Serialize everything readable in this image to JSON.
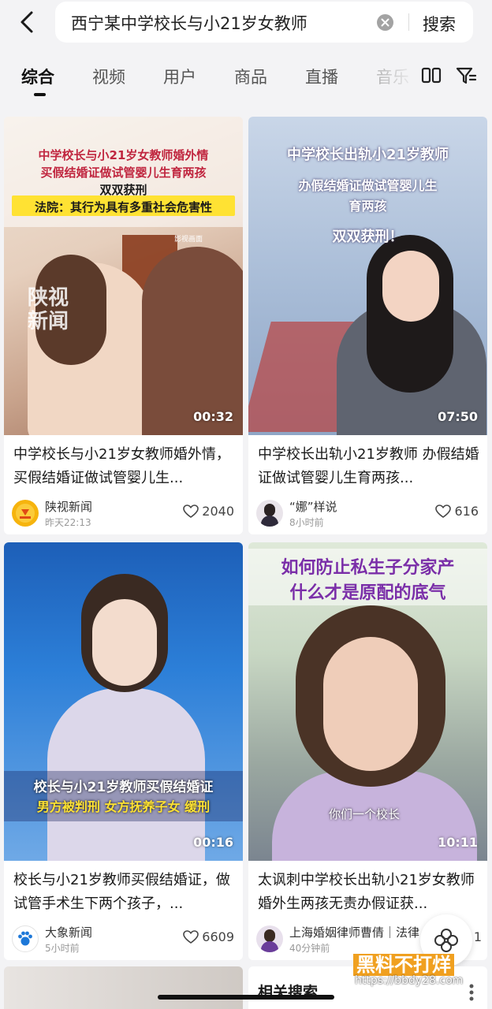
{
  "search": {
    "query": "西宁某中学校长与小21岁女教师",
    "button_label": "搜索"
  },
  "tabs": [
    {
      "label": "综合",
      "active": true
    },
    {
      "label": "视频",
      "active": false
    },
    {
      "label": "用户",
      "active": false
    },
    {
      "label": "商品",
      "active": false
    },
    {
      "label": "直播",
      "active": false
    },
    {
      "label": "音乐",
      "active": false
    }
  ],
  "cards": [
    {
      "duration": "00:32",
      "title": "中学校长与小21岁女教师婚外情，买假结婚证做试管婴儿生...",
      "author": "陕视新闻",
      "time": "昨天22:13",
      "likes": "2040",
      "overlay": [
        "中学校长与小21岁女教师婚外情",
        "买假结婚证做试管婴儿生育两孩",
        "双双获刑",
        "法院：其行为具有多重社会危害性"
      ],
      "watermark": "陕视\n新闻",
      "tag": "影视画面",
      "avatar_text": "陕视新闻"
    },
    {
      "duration": "07:50",
      "title": "中学校长出轨小21岁教师 办假结婚证做试管婴儿生育两孩...",
      "author": "“娜”样说",
      "time": "8小时前",
      "likes": "616",
      "overlay": [
        "中学校长出轨小21岁教师",
        "办假结婚证做试管婴儿生",
        "育两孩",
        "双双获刑！"
      ]
    },
    {
      "duration": "00:16",
      "title": "校长与小21岁教师买假结婚证，做试管手术生下两个孩子，...",
      "author": "大象新闻",
      "time": "5小时前",
      "likes": "6609",
      "overlay": [
        "校长与小21岁教师买假结婚证",
        "男方被判刑 女方抚养子女 缓刑"
      ],
      "avatar_text": "大象新闻"
    },
    {
      "duration": "10:11",
      "title": "太讽刺中学校长出轨小21岁女教师婚外生两孩无责办假证获...",
      "author": "上海婚姻律师曹倩｜法律",
      "time": "40分钟前",
      "likes": "1",
      "overlay": [
        "如何防止私生子分家产",
        "什么才是原配的底气"
      ],
      "subtitle": "你们一个校长"
    }
  ],
  "bottom": {
    "related_label": "相关搜索",
    "watermark_brand": "黑料不打烊",
    "watermark_url": "https://bbdy28.com"
  },
  "colors": {
    "background": "#f3f3f5",
    "overlay_yellow": "#ffe233",
    "overlay_purple": "#7a2ea8"
  }
}
